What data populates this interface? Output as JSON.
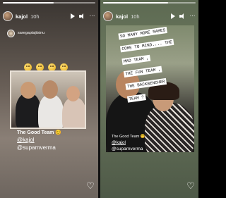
{
  "stories": [
    {
      "progress": 0.55,
      "header": {
        "username": "kajol",
        "time": "10h"
      },
      "reposted_from": "saregaptajiisinu",
      "emojis": [
        "laughing-emoji",
        "laughing-emoji",
        "laughing-emoji",
        "laughing-emoji"
      ],
      "caption": {
        "title": "The Good Team 😊",
        "tag1": "@kajol",
        "tag2": "@suparnverma"
      }
    },
    {
      "progress": 0.7,
      "header": {
        "username": "kajol",
        "time": "10h"
      },
      "notes": [
        "SO MANY MORE NAMES",
        "COME TO MIND.... THE",
        "MAD TEAM ,",
        "THE FUN TEAM ,",
        "THE BACKBENCHER",
        "TEAM ?"
      ],
      "caption": {
        "title": "The Good Team 😊",
        "tag1": "@kajol",
        "tag2": "@suparnverma"
      }
    }
  ],
  "colors": {
    "accent_white": "#ffffff",
    "divider": "#111111"
  }
}
